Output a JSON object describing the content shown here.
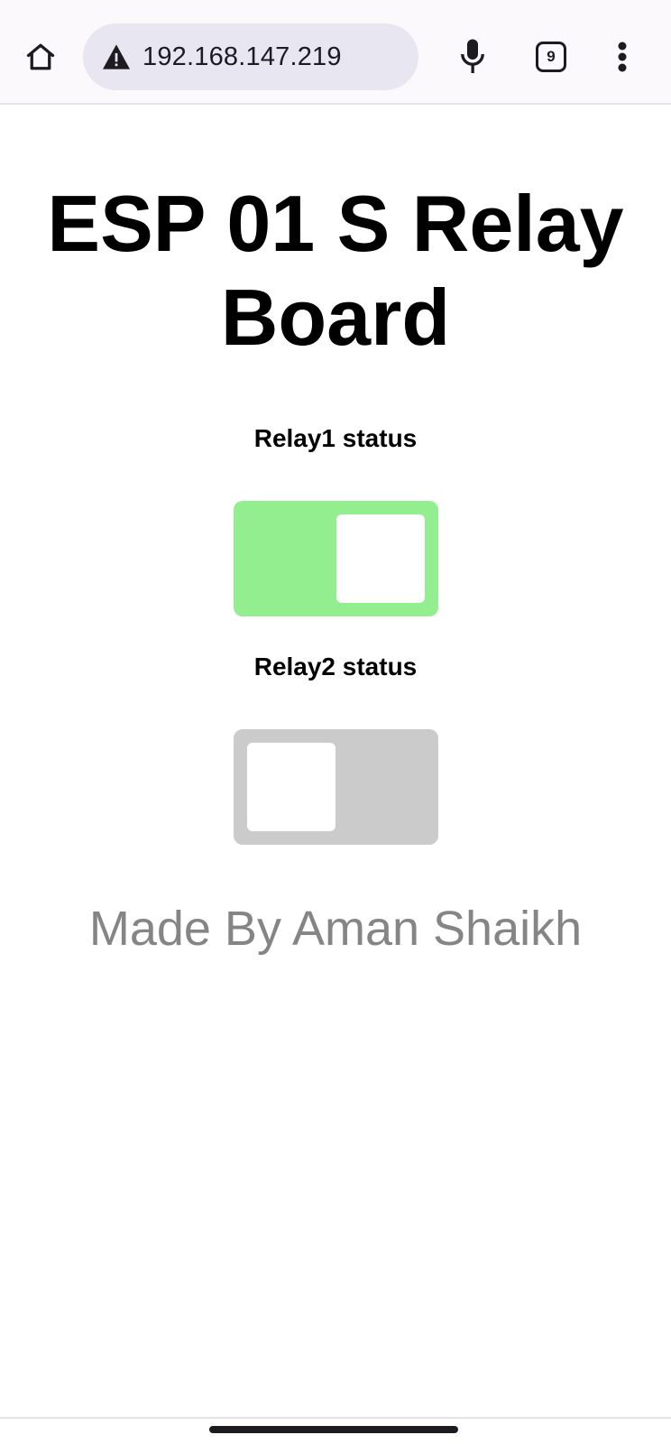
{
  "browser": {
    "url": "192.168.147.219",
    "tab_count": "9",
    "icons": {
      "home": "home-icon",
      "warning": "warning-triangle-icon",
      "mic": "microphone-icon",
      "tabs": "tab-switcher-icon",
      "menu": "more-vert-icon"
    }
  },
  "page": {
    "title": "ESP 01 S Relay Board",
    "relays": [
      {
        "label": "Relay1 status",
        "on": true
      },
      {
        "label": "Relay2 status",
        "on": false
      }
    ],
    "footer": "Made By Aman Shaikh"
  },
  "colors": {
    "switch_on": "#92ee8f",
    "switch_off": "#cbcbcb",
    "footer_text": "#858585"
  }
}
